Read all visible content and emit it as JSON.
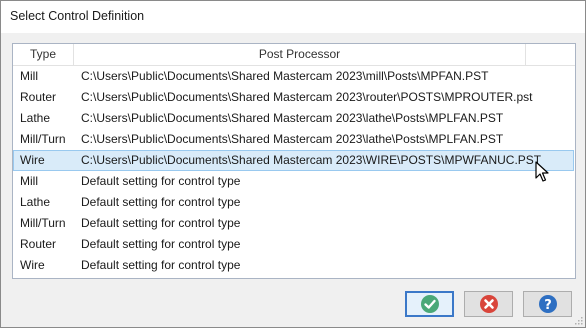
{
  "window": {
    "title": "Select Control Definition"
  },
  "list": {
    "columns": {
      "type": "Type",
      "post": "Post Processor"
    },
    "rows": [
      {
        "type": "Mill",
        "post": "C:\\Users\\Public\\Documents\\Shared Mastercam 2023\\mill\\Posts\\MPFAN.PST"
      },
      {
        "type": "Router",
        "post": "C:\\Users\\Public\\Documents\\Shared Mastercam 2023\\router\\POSTS\\MPROUTER.pst"
      },
      {
        "type": "Lathe",
        "post": "C:\\Users\\Public\\Documents\\Shared Mastercam 2023\\lathe\\Posts\\MPLFAN.PST"
      },
      {
        "type": "Mill/Turn",
        "post": "C:\\Users\\Public\\Documents\\Shared Mastercam 2023\\lathe\\Posts\\MPLFAN.PST"
      },
      {
        "type": "Wire",
        "post": "C:\\Users\\Public\\Documents\\Shared Mastercam 2023\\WIRE\\POSTS\\MPWFANUC.PST",
        "selected": true
      },
      {
        "type": "Mill",
        "post": "Default setting for control type"
      },
      {
        "type": "Lathe",
        "post": "Default setting for control type"
      },
      {
        "type": "Mill/Turn",
        "post": "Default setting for control type"
      },
      {
        "type": "Router",
        "post": "Default setting for control type"
      },
      {
        "type": "Wire",
        "post": "Default setting for control type"
      }
    ]
  },
  "buttons": {
    "ok": {
      "icon": "checkmark-icon",
      "color": "#3f9c6c"
    },
    "cancel": {
      "icon": "cancel-x-icon",
      "color": "#d9453b"
    },
    "help": {
      "icon": "help-question-icon",
      "color": "#2e6fc2"
    }
  }
}
